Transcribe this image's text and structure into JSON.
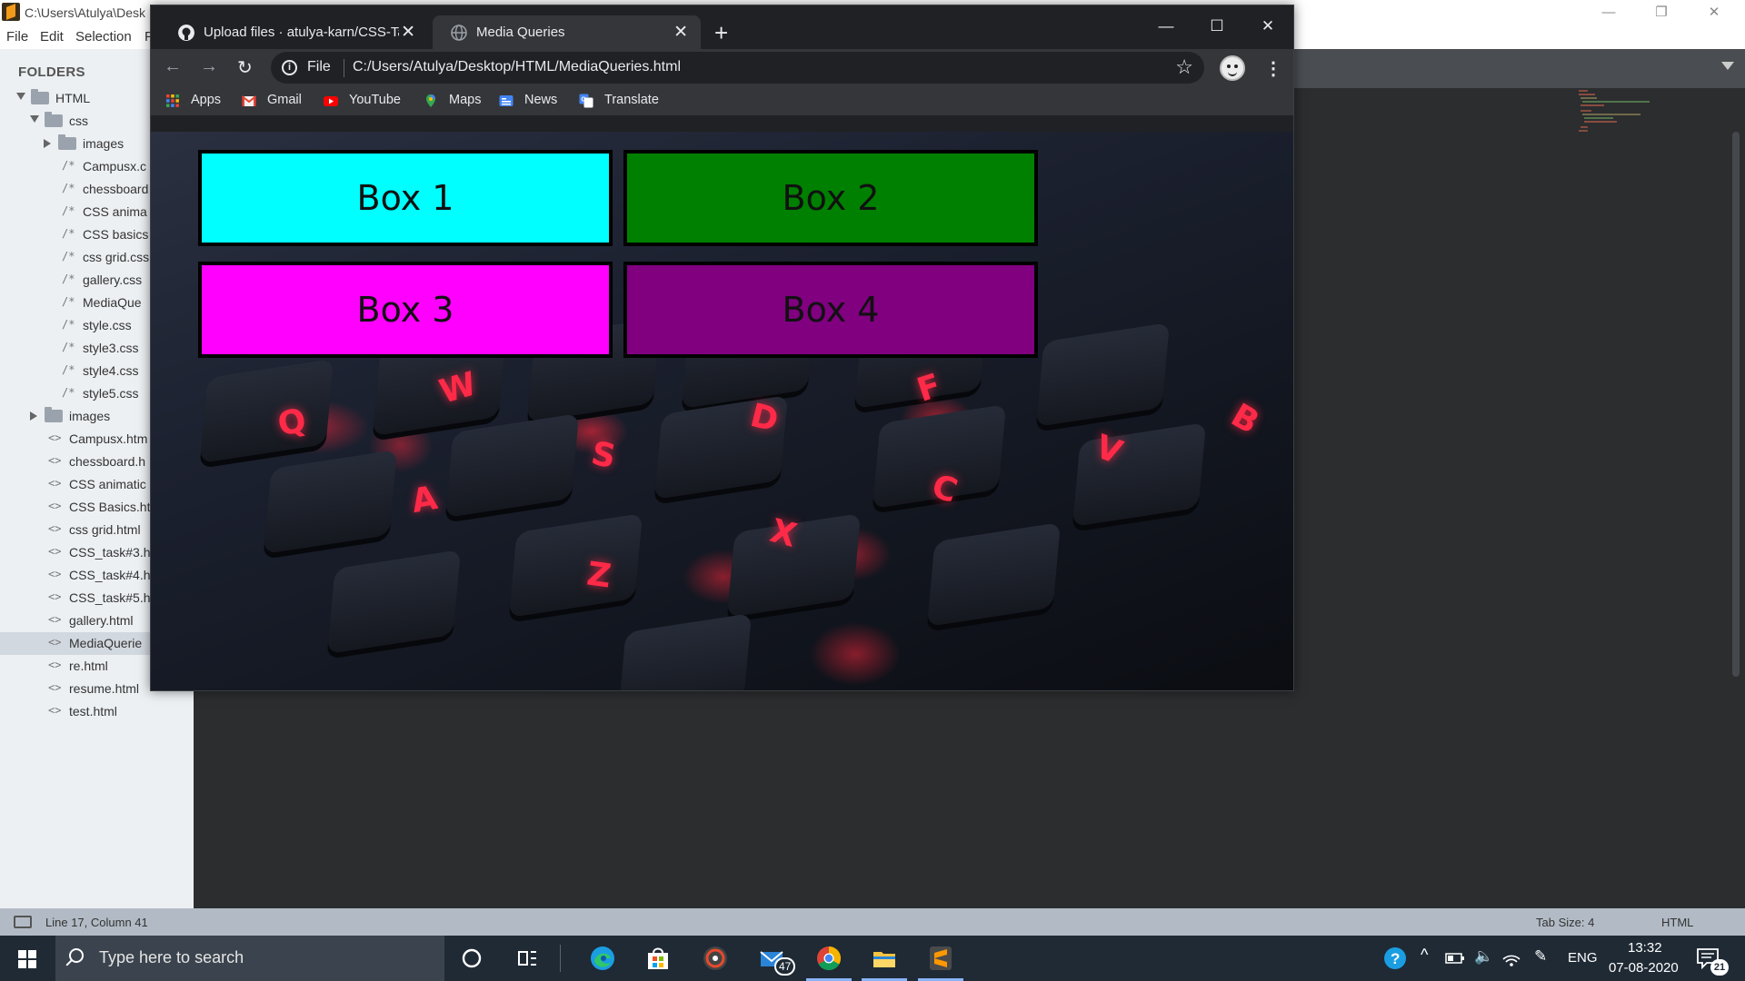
{
  "sublime": {
    "title": "C:\\Users\\Atulya\\Desk",
    "menu": [
      "File",
      "Edit",
      "Selection",
      "F"
    ],
    "sidebar": {
      "header": "FOLDERS",
      "rows": [
        {
          "label": "HTML",
          "type": "folder-open",
          "indent": 0
        },
        {
          "label": "css",
          "type": "folder-open",
          "indent": 1
        },
        {
          "label": "images",
          "type": "folder-closed",
          "indent": 2
        },
        {
          "label": "Campusx.c",
          "type": "css",
          "indent": 2
        },
        {
          "label": "chessboard",
          "type": "css",
          "indent": 2
        },
        {
          "label": "CSS anima",
          "type": "css",
          "indent": 2
        },
        {
          "label": "CSS basics",
          "type": "css",
          "indent": 2
        },
        {
          "label": "css grid.css",
          "type": "css",
          "indent": 2
        },
        {
          "label": "gallery.css",
          "type": "css",
          "indent": 2
        },
        {
          "label": "MediaQue",
          "type": "css",
          "indent": 2
        },
        {
          "label": "style.css",
          "type": "css",
          "indent": 2
        },
        {
          "label": "style3.css",
          "type": "css",
          "indent": 2
        },
        {
          "label": "style4.css",
          "type": "css",
          "indent": 2
        },
        {
          "label": "style5.css",
          "type": "css",
          "indent": 2
        },
        {
          "label": "images",
          "type": "folder-closed",
          "indent": 1
        },
        {
          "label": "Campusx.htm",
          "type": "html",
          "indent": 1
        },
        {
          "label": "chessboard.h",
          "type": "html",
          "indent": 1
        },
        {
          "label": "CSS animatic",
          "type": "html",
          "indent": 1
        },
        {
          "label": "CSS Basics.ht",
          "type": "html",
          "indent": 1
        },
        {
          "label": "css grid.html",
          "type": "html",
          "indent": 1
        },
        {
          "label": "CSS_task#3.h",
          "type": "html",
          "indent": 1
        },
        {
          "label": "CSS_task#4.h",
          "type": "html",
          "indent": 1
        },
        {
          "label": "CSS_task#5.h",
          "type": "html",
          "indent": 1
        },
        {
          "label": "gallery.html",
          "type": "html",
          "indent": 1
        },
        {
          "label": "MediaQuerie",
          "type": "html",
          "indent": 1,
          "selected": true
        },
        {
          "label": "re.html",
          "type": "html",
          "indent": 1
        },
        {
          "label": "resume.html",
          "type": "html",
          "indent": 1
        },
        {
          "label": "test.html",
          "type": "html",
          "indent": 1
        }
      ]
    },
    "status": {
      "position": "Line 17, Column 41",
      "tab_size": "Tab Size: 4",
      "syntax": "HTML"
    }
  },
  "chrome": {
    "tabs": [
      {
        "title": "Upload files · atulya-karn/CSS-Ta",
        "icon": "github-icon",
        "active": false
      },
      {
        "title": "Media Queries",
        "icon": "globe-icon",
        "active": true
      }
    ],
    "new_tab": "+",
    "window_controls": {
      "minimize": "—",
      "maximize": "☐",
      "close": "✕"
    },
    "omnibox": {
      "scheme": "File",
      "url": "C:/Users/Atulya/Desktop/HTML/MediaQueries.html"
    },
    "bookmarks": [
      {
        "label": "Apps",
        "icon": "apps-grid-icon"
      },
      {
        "label": "Gmail",
        "icon": "gmail-icon"
      },
      {
        "label": "YouTube",
        "icon": "youtube-icon"
      },
      {
        "label": "Maps",
        "icon": "maps-pin-icon"
      },
      {
        "label": "News",
        "icon": "news-icon"
      },
      {
        "label": "Translate",
        "icon": "translate-icon"
      }
    ]
  },
  "page": {
    "boxes": [
      {
        "label": "Box 1",
        "color": "#00ffff"
      },
      {
        "label": "Box 2",
        "color": "#008000"
      },
      {
        "label": "Box 3",
        "color": "#ff00ff"
      },
      {
        "label": "Box 4",
        "color": "#800080"
      }
    ],
    "keycaps": [
      "Q",
      "W",
      "F",
      "D",
      "B",
      "S",
      "V",
      "A",
      "C",
      "X",
      "Z"
    ]
  },
  "taskbar": {
    "search_placeholder": "Type here to search",
    "mail_badge": "47",
    "language": "ENG",
    "time": "13:32",
    "date": "07-08-2020",
    "notifications_badge": "21"
  }
}
